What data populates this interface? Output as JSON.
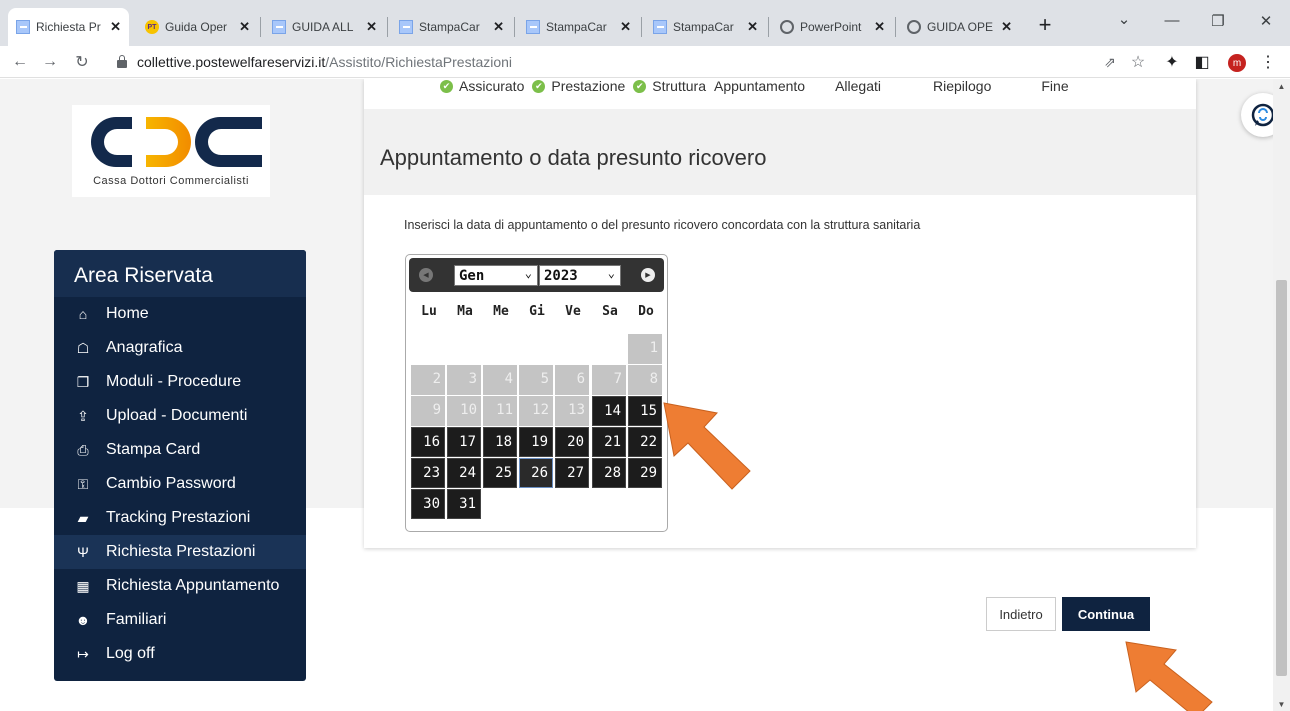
{
  "browser": {
    "tabs": [
      {
        "title": "Richiesta Pr",
        "icon": "doc-icon",
        "active": true
      },
      {
        "title": "Guida Oper",
        "icon": "pt-icon"
      },
      {
        "title": "GUIDA ALL",
        "icon": "doc-icon"
      },
      {
        "title": "StampaCar",
        "icon": "doc-icon"
      },
      {
        "title": "StampaCar",
        "icon": "doc-icon"
      },
      {
        "title": "StampaCar",
        "icon": "doc-icon"
      },
      {
        "title": "PowerPoint",
        "icon": "globe-icon"
      },
      {
        "title": "GUIDA OPE",
        "icon": "globe-icon"
      }
    ],
    "url_host": "collettive.postewelfareservizi.it",
    "url_path": "/Assistito/RichiestaPrestazioni",
    "profile_initial": "m",
    "profile_color": "#c5221f"
  },
  "logo": {
    "subtitle": "Cassa Dottori Commercialisti"
  },
  "sidebar": {
    "title": "Area Riservata",
    "items": [
      {
        "label": "Home",
        "icon": "home-icon",
        "glyph": "⌂"
      },
      {
        "label": "Anagrafica",
        "icon": "bank-icon",
        "glyph": "☖"
      },
      {
        "label": "Moduli - Procedure",
        "icon": "copy-icon",
        "glyph": "❐"
      },
      {
        "label": "Upload - Documenti",
        "icon": "upload-icon",
        "glyph": "⇪"
      },
      {
        "label": "Stampa Card",
        "icon": "print-icon",
        "glyph": "⎙"
      },
      {
        "label": "Cambio Password",
        "icon": "key-icon",
        "glyph": "⚿"
      },
      {
        "label": "Tracking Prestazioni",
        "icon": "book-icon",
        "glyph": "▰"
      },
      {
        "label": "Richiesta Prestazioni",
        "icon": "stethoscope-icon",
        "glyph": "Ψ",
        "active": true
      },
      {
        "label": "Richiesta Appuntamento",
        "icon": "calendar-icon",
        "glyph": "▦"
      },
      {
        "label": "Familiari",
        "icon": "users-icon",
        "glyph": "☻"
      },
      {
        "label": "Log off",
        "icon": "logoff-icon",
        "glyph": "↦"
      }
    ]
  },
  "steps": {
    "done": [
      "Assicurato",
      "Prestazione",
      "Struttura"
    ],
    "pending": [
      "Appuntamento",
      "Allegati",
      "Riepilogo",
      "Fine"
    ]
  },
  "card": {
    "title": "Appuntamento o data presunto ricovero",
    "instruction": "Inserisci la data di appuntamento o del presunto ricovero concordata con la struttura sanitaria"
  },
  "datepicker": {
    "month": "Gen",
    "year": "2023",
    "weekdays": [
      "Lu",
      "Ma",
      "Me",
      "Gi",
      "Ve",
      "Sa",
      "Do"
    ],
    "first_weekday_index": 6,
    "days_in_month": 31,
    "first_enabled_day": 14,
    "selected_day": 26
  },
  "buttons": {
    "back": "Indietro",
    "continue": "Continua"
  },
  "colors": {
    "sidebar_bg": "#0f2340",
    "accent_arrow": "#ee7d33",
    "check_green": "#7cbf4a"
  }
}
